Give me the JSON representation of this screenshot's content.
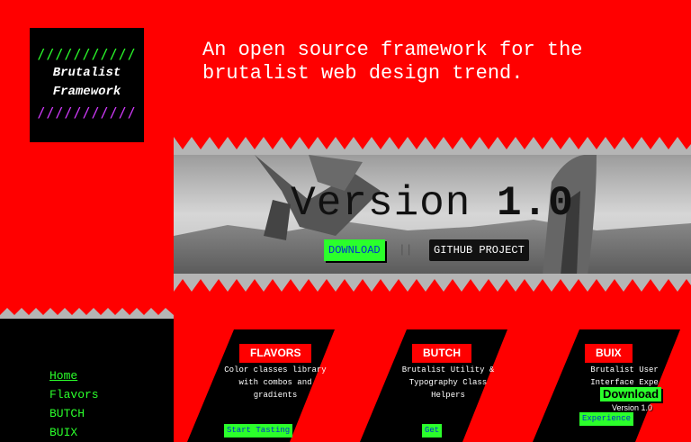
{
  "logo": {
    "top_slashes": "///////////",
    "line1": "Brutalist",
    "line2": "Framework",
    "bottom_slashes": "///////////"
  },
  "tagline": "An open source framework for the brutalist web design trend.",
  "hero": {
    "version_label": "Version",
    "version_number": "1.0",
    "download_label": "DOWNLOAD",
    "separator": "||",
    "github_label": "GITHUB PROJECT"
  },
  "nav": {
    "items": [
      "Home",
      "Flavors",
      "BUTCH",
      "BUIX"
    ]
  },
  "cards": [
    {
      "title": "FLAVORS",
      "description": "Color classes library with combos and gradients",
      "cta": "Start Tasting"
    },
    {
      "title": "BUTCH",
      "description": "Brutalist Utility & Typography Class Helpers",
      "cta": "Get"
    },
    {
      "title": "BUIX",
      "description": "Brutalist User Interface Expe",
      "cta": "Experience"
    }
  ],
  "buix_badge": {
    "label": "Download",
    "version": "Version 1.0"
  },
  "colors": {
    "background": "#ff0000",
    "accent_green": "#2bff2b",
    "accent_purple": "#d43bff",
    "black": "#000000"
  }
}
